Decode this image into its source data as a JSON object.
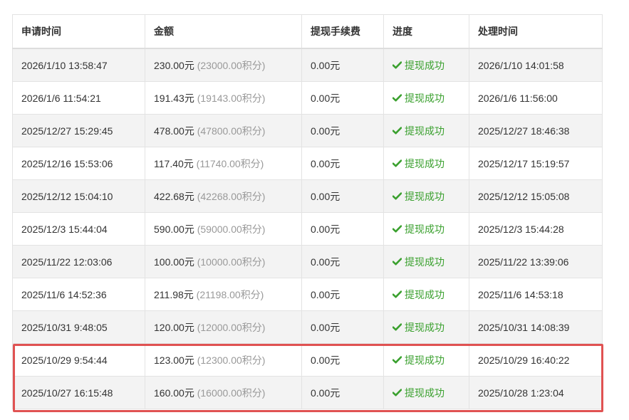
{
  "columns": [
    "申请时间",
    "金额",
    "提现手续费",
    "进度",
    "处理时间"
  ],
  "status_color": "#3aa02e",
  "highlight_color": "#e05252",
  "rows": [
    {
      "apply_time": "2026/1/10 13:58:47",
      "amount": "230.00元",
      "points": "(23000.00积分)",
      "fee": "0.00元",
      "status": "提现成功",
      "process_time": "2026/1/10 14:01:58"
    },
    {
      "apply_time": "2026/1/6 11:54:21",
      "amount": "191.43元",
      "points": "(19143.00积分)",
      "fee": "0.00元",
      "status": "提现成功",
      "process_time": "2026/1/6 11:56:00"
    },
    {
      "apply_time": "2025/12/27 15:29:45",
      "amount": "478.00元",
      "points": "(47800.00积分)",
      "fee": "0.00元",
      "status": "提现成功",
      "process_time": "2025/12/27 18:46:38"
    },
    {
      "apply_time": "2025/12/16 15:53:06",
      "amount": "117.40元",
      "points": "(11740.00积分)",
      "fee": "0.00元",
      "status": "提现成功",
      "process_time": "2025/12/17 15:19:57"
    },
    {
      "apply_time": "2025/12/12 15:04:10",
      "amount": "422.68元",
      "points": "(42268.00积分)",
      "fee": "0.00元",
      "status": "提现成功",
      "process_time": "2025/12/12 15:05:08"
    },
    {
      "apply_time": "2025/12/3 15:44:04",
      "amount": "590.00元",
      "points": "(59000.00积分)",
      "fee": "0.00元",
      "status": "提现成功",
      "process_time": "2025/12/3 15:44:28"
    },
    {
      "apply_time": "2025/11/22 12:03:06",
      "amount": "100.00元",
      "points": "(10000.00积分)",
      "fee": "0.00元",
      "status": "提现成功",
      "process_time": "2025/11/22 13:39:06"
    },
    {
      "apply_time": "2025/11/6 14:52:36",
      "amount": "211.98元",
      "points": "(21198.00积分)",
      "fee": "0.00元",
      "status": "提现成功",
      "process_time": "2025/11/6 14:53:18"
    },
    {
      "apply_time": "2025/10/31 9:48:05",
      "amount": "120.00元",
      "points": "(12000.00积分)",
      "fee": "0.00元",
      "status": "提现成功",
      "process_time": "2025/10/31 14:08:39"
    },
    {
      "apply_time": "2025/10/29 9:54:44",
      "amount": "123.00元",
      "points": "(12300.00积分)",
      "fee": "0.00元",
      "status": "提现成功",
      "process_time": "2025/10/29 16:40:22"
    },
    {
      "apply_time": "2025/10/27 16:15:48",
      "amount": "160.00元",
      "points": "(16000.00积分)",
      "fee": "0.00元",
      "status": "提现成功",
      "process_time": "2025/10/28 1:23:04"
    }
  ]
}
